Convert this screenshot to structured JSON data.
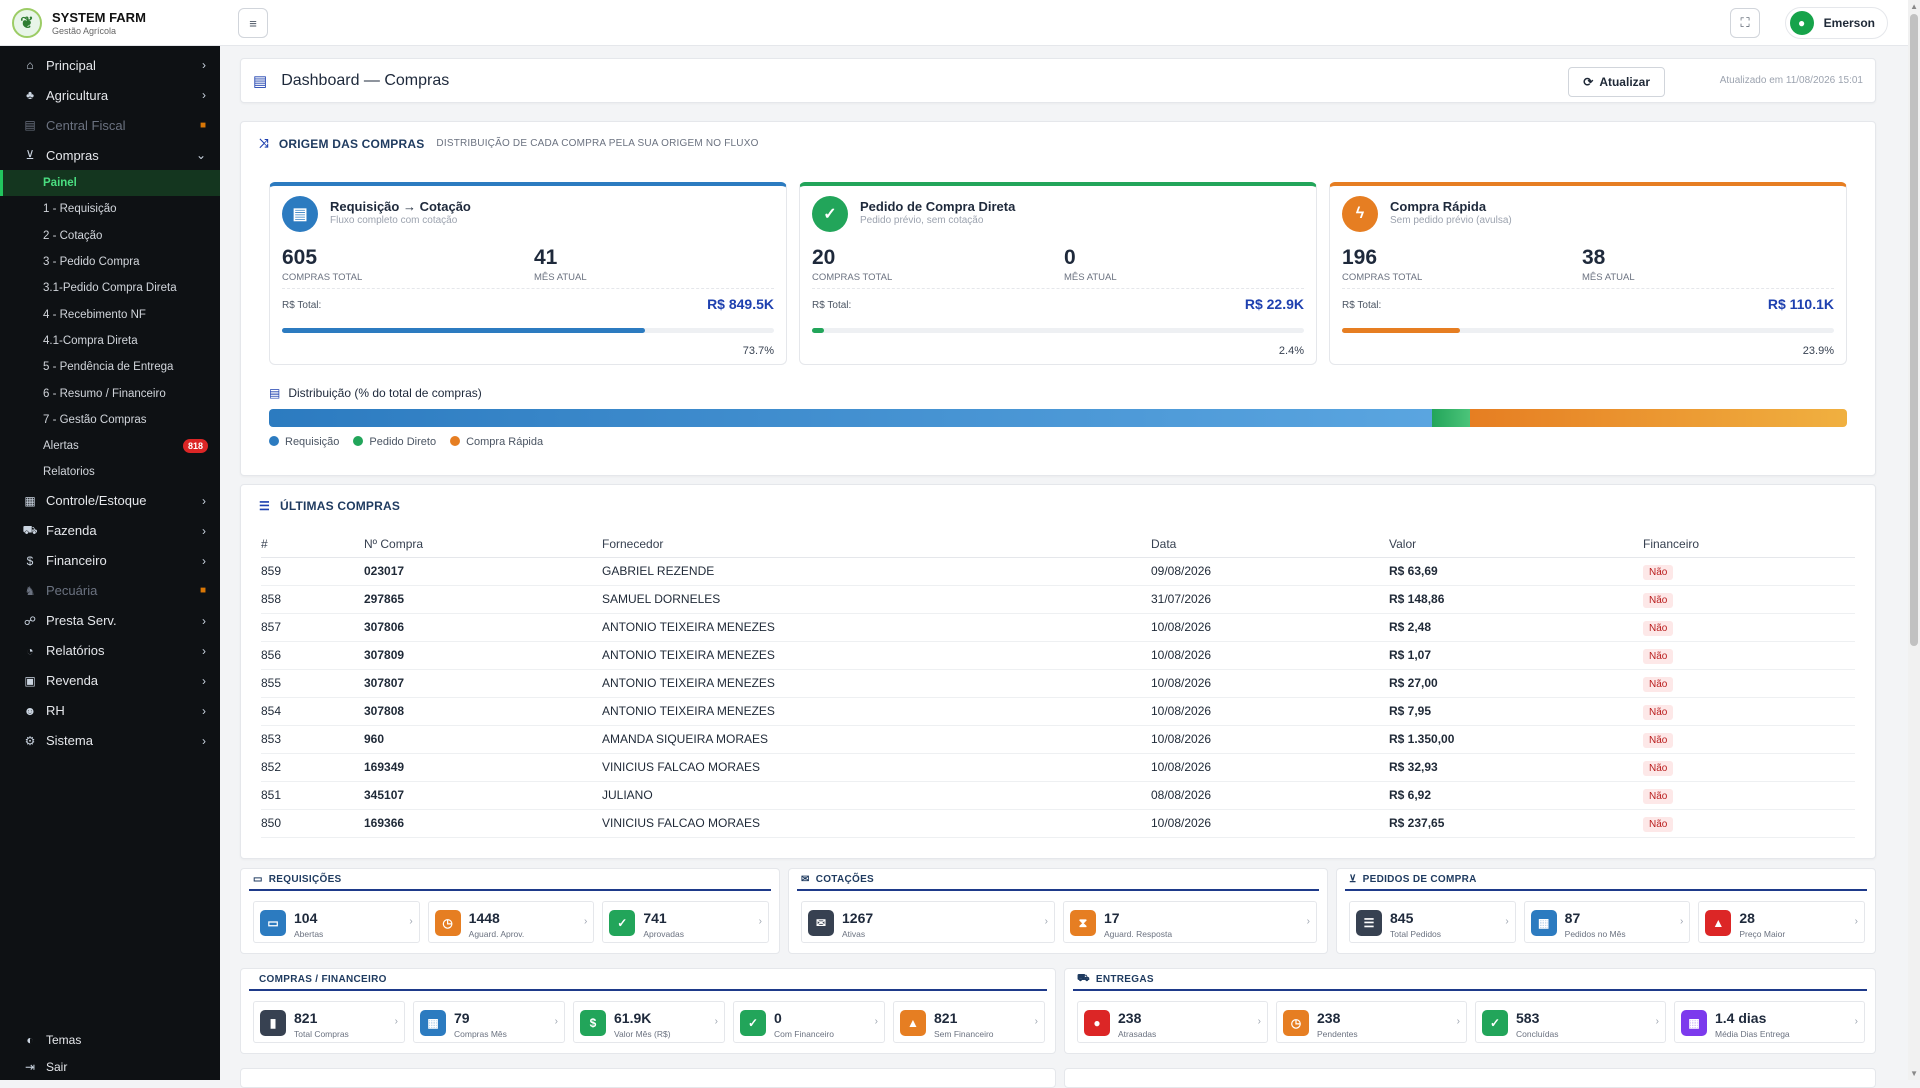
{
  "brand": {
    "title": "SYSTEM FARM",
    "subtitle": "Gestão Agrícola"
  },
  "sidebar": {
    "items": [
      {
        "label": "Principal",
        "icon": "home-icon"
      },
      {
        "label": "Agricultura",
        "icon": "plant-icon"
      },
      {
        "label": "Central Fiscal",
        "icon": "receipt-icon",
        "locked": true
      },
      {
        "label": "Compras",
        "icon": "cart-icon",
        "open": true
      }
    ],
    "compras_sub": [
      {
        "label": "Painel",
        "active": true
      },
      {
        "label": "1 - Requisição"
      },
      {
        "label": "2 - Cotação"
      },
      {
        "label": "3 - Pedido Compra"
      },
      {
        "label": "3.1-Pedido Compra Direta"
      },
      {
        "label": "4 - Recebimento NF"
      },
      {
        "label": "4.1-Compra Direta"
      },
      {
        "label": "5 - Pendência de Entrega"
      },
      {
        "label": "6 - Resumo / Financeiro"
      },
      {
        "label": "7 - Gestão Compras"
      },
      {
        "label": "Alertas",
        "badge": "818"
      },
      {
        "label": "Relatorios"
      }
    ],
    "items2": [
      {
        "label": "Controle/Estoque",
        "icon": "boxes-icon"
      },
      {
        "label": "Fazenda",
        "icon": "tractor-icon"
      },
      {
        "label": "Financeiro",
        "icon": "money-icon"
      },
      {
        "label": "Pecuária",
        "icon": "cow-icon",
        "locked": true
      },
      {
        "label": "Presta Serv.",
        "icon": "handshake-icon"
      },
      {
        "label": "Relatórios",
        "icon": "report-icon"
      },
      {
        "label": "Revenda",
        "icon": "store-icon"
      },
      {
        "label": "RH",
        "icon": "users-icon"
      },
      {
        "label": "Sistema",
        "icon": "gear-icon"
      }
    ],
    "bottom": [
      {
        "label": "Temas",
        "icon": "palette-icon"
      },
      {
        "label": "Sair",
        "icon": "logout-icon"
      }
    ]
  },
  "topbar": {
    "user": "Emerson"
  },
  "header": {
    "title": "Dashboard — Compras",
    "refresh": "Atualizar",
    "updated": "Atualizado em 11/08/2026 15:01"
  },
  "origin": {
    "title": "ORIGEM DAS COMPRAS",
    "subtitle": "DISTRIBUIÇÃO DE CADA COMPRA PELA SUA ORIGEM NO FLUXO",
    "cards": [
      {
        "title": "Requisição → Cotação",
        "sub": "Fluxo completo com cotação",
        "total": "605",
        "total_label": "COMPRAS TOTAL",
        "month": "41",
        "month_label": "MÊS ATUAL",
        "value_label": "R$ Total:",
        "value": "R$ 849.5K",
        "pct": "73.7%",
        "fraction": 0.737,
        "color": "#2c7bc0",
        "icon": "clipboard-icon"
      },
      {
        "title": "Pedido de Compra Direta",
        "sub": "Pedido prévio, sem cotação",
        "total": "20",
        "total_label": "COMPRAS TOTAL",
        "month": "0",
        "month_label": "MÊS ATUAL",
        "value_label": "R$ Total:",
        "value": "R$ 22.9K",
        "pct": "2.4%",
        "fraction": 0.024,
        "color": "#22a55a",
        "icon": "clipboard-check-icon"
      },
      {
        "title": "Compra Rápida",
        "sub": "Sem pedido prévio (avulsa)",
        "total": "196",
        "total_label": "COMPRAS TOTAL",
        "month": "38",
        "month_label": "MÊS ATUAL",
        "value_label": "R$ Total:",
        "value": "R$ 110.1K",
        "pct": "23.9%",
        "fraction": 0.239,
        "color": "#e67e22",
        "icon": "bolt-icon"
      }
    ],
    "dist_title": "Distribuição (% do total de compras)",
    "legend": [
      "Requisição",
      "Pedido Direto",
      "Compra Rápida"
    ]
  },
  "last": {
    "title": "ÚLTIMAS COMPRAS",
    "columns": [
      "#",
      "Nº Compra",
      "Fornecedor",
      "Data",
      "Valor",
      "Financeiro"
    ],
    "rows": [
      [
        "859",
        "023017",
        "GABRIEL REZENDE",
        "09/08/2026",
        "R$ 63,69",
        "Não"
      ],
      [
        "858",
        "297865",
        "SAMUEL DORNELES",
        "31/07/2026",
        "R$ 148,86",
        "Não"
      ],
      [
        "857",
        "307806",
        "ANTONIO TEIXEIRA MENEZES",
        "10/08/2026",
        "R$ 2,48",
        "Não"
      ],
      [
        "856",
        "307809",
        "ANTONIO TEIXEIRA MENEZES",
        "10/08/2026",
        "R$ 1,07",
        "Não"
      ],
      [
        "855",
        "307807",
        "ANTONIO TEIXEIRA MENEZES",
        "10/08/2026",
        "R$ 27,00",
        "Não"
      ],
      [
        "854",
        "307808",
        "ANTONIO TEIXEIRA MENEZES",
        "10/08/2026",
        "R$ 7,95",
        "Não"
      ],
      [
        "853",
        "960",
        "AMANDA SIQUEIRA MORAES",
        "10/08/2026",
        "R$ 1.350,00",
        "Não"
      ],
      [
        "852",
        "169349",
        "VINICIUS FALCAO MORAES",
        "10/08/2026",
        "R$ 32,93",
        "Não"
      ],
      [
        "851",
        "345107",
        "JULIANO",
        "08/08/2026",
        "R$ 6,92",
        "Não"
      ],
      [
        "850",
        "169366",
        "VINICIUS FALCAO MORAES",
        "10/08/2026",
        "R$ 237,65",
        "Não"
      ]
    ]
  },
  "panels": {
    "requisicoes": {
      "title": "REQUISIÇÕES",
      "kpis": [
        {
          "value": "104",
          "label": "Abertas",
          "color": "#2c7bc0",
          "icon": "folder-icon"
        },
        {
          "value": "1448",
          "label": "Aguard. Aprov.",
          "color": "#e67e22",
          "icon": "clock-icon"
        },
        {
          "value": "741",
          "label": "Aprovadas",
          "color": "#22a55a",
          "icon": "check-circle-icon"
        }
      ]
    },
    "cotacoes": {
      "title": "COTAÇÕES",
      "kpis": [
        {
          "value": "1267",
          "label": "Ativas",
          "color": "#374151",
          "icon": "envelope-icon"
        },
        {
          "value": "17",
          "label": "Aguard. Resposta",
          "color": "#e67e22",
          "icon": "hourglass-icon"
        }
      ]
    },
    "pedidos": {
      "title": "PEDIDOS DE COMPRA",
      "kpis": [
        {
          "value": "845",
          "label": "Total Pedidos",
          "color": "#374151",
          "icon": "list-icon"
        },
        {
          "value": "87",
          "label": "Pedidos no Mês",
          "color": "#2c7bc0",
          "icon": "calendar-check-icon"
        },
        {
          "value": "28",
          "label": "Preço Maior",
          "color": "#dc2626",
          "icon": "warning-icon"
        }
      ]
    },
    "financeiro": {
      "title": "COMPRAS / FINANCEIRO",
      "kpis": [
        {
          "value": "821",
          "label": "Total Compras",
          "color": "#374151",
          "icon": "bag-icon"
        },
        {
          "value": "79",
          "label": "Compras Mês",
          "color": "#2c7bc0",
          "icon": "calendar-icon"
        },
        {
          "value": "61.9K",
          "label": "Valor Mês (R$)",
          "color": "#22a55a",
          "icon": "dollar-icon"
        },
        {
          "value": "0",
          "label": "Com Financeiro",
          "color": "#22a55a",
          "icon": "check-icon"
        },
        {
          "value": "821",
          "label": "Sem Financeiro",
          "color": "#e67e22",
          "icon": "warning-icon"
        }
      ]
    },
    "entregas": {
      "title": "ENTREGAS",
      "kpis": [
        {
          "value": "238",
          "label": "Atrasadas",
          "color": "#dc2626",
          "icon": "alert-circle-icon"
        },
        {
          "value": "238",
          "label": "Pendentes",
          "color": "#e67e22",
          "icon": "clock-icon"
        },
        {
          "value": "583",
          "label": "Concluídas",
          "color": "#22a55a",
          "icon": "check-circle-icon"
        },
        {
          "value": "1.4 dias",
          "label": "Média Dias Entrega",
          "color": "#7c3aed",
          "icon": "calendar-icon"
        }
      ]
    }
  }
}
